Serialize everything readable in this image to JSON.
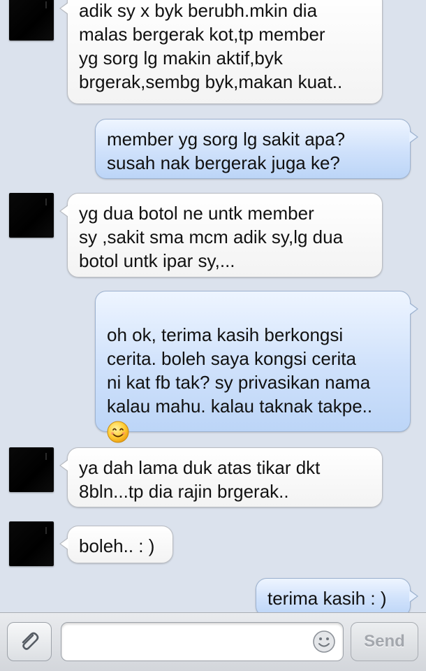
{
  "messages": [
    {
      "side": "in",
      "text": "adik sy x byk berubh.mkin dia\nmalas bergerak kot,tp member\nyg sorg lg makin aktif,byk\nbrgerak,sembg byk,makan kuat.."
    },
    {
      "side": "out",
      "text": "member yg sorg lg sakit apa?\nsusah nak bergerak juga ke?"
    },
    {
      "side": "in",
      "text": "yg dua botol ne untk member\nsy ,sakit sma mcm adik sy,lg dua\nbotol untk ipar sy,..."
    },
    {
      "side": "out",
      "text": "oh ok, terima kasih berkongsi\ncerita. boleh saya kongsi cerita\nni kat fb tak? sy privasikan nama\nkalau mahu. kalau taknak takpe..",
      "emoji": "smiling-face"
    },
    {
      "side": "in",
      "text": "ya dah lama duk atas tikar dkt\n8bln...tp dia rajin brgerak.."
    },
    {
      "side": "in",
      "text": "boleh.. : )"
    },
    {
      "side": "out",
      "text": "terima kasih : )"
    }
  ],
  "composer": {
    "placeholder": "",
    "send_label": "Send",
    "attach_icon": "paperclip-icon",
    "emoji_icon": "smiley-icon"
  },
  "colors": {
    "background": "#dbe2ed",
    "incoming_bubble": "#ffffff",
    "outgoing_bubble": "#cfe1fb",
    "send_disabled_text": "#a3a7ad"
  }
}
